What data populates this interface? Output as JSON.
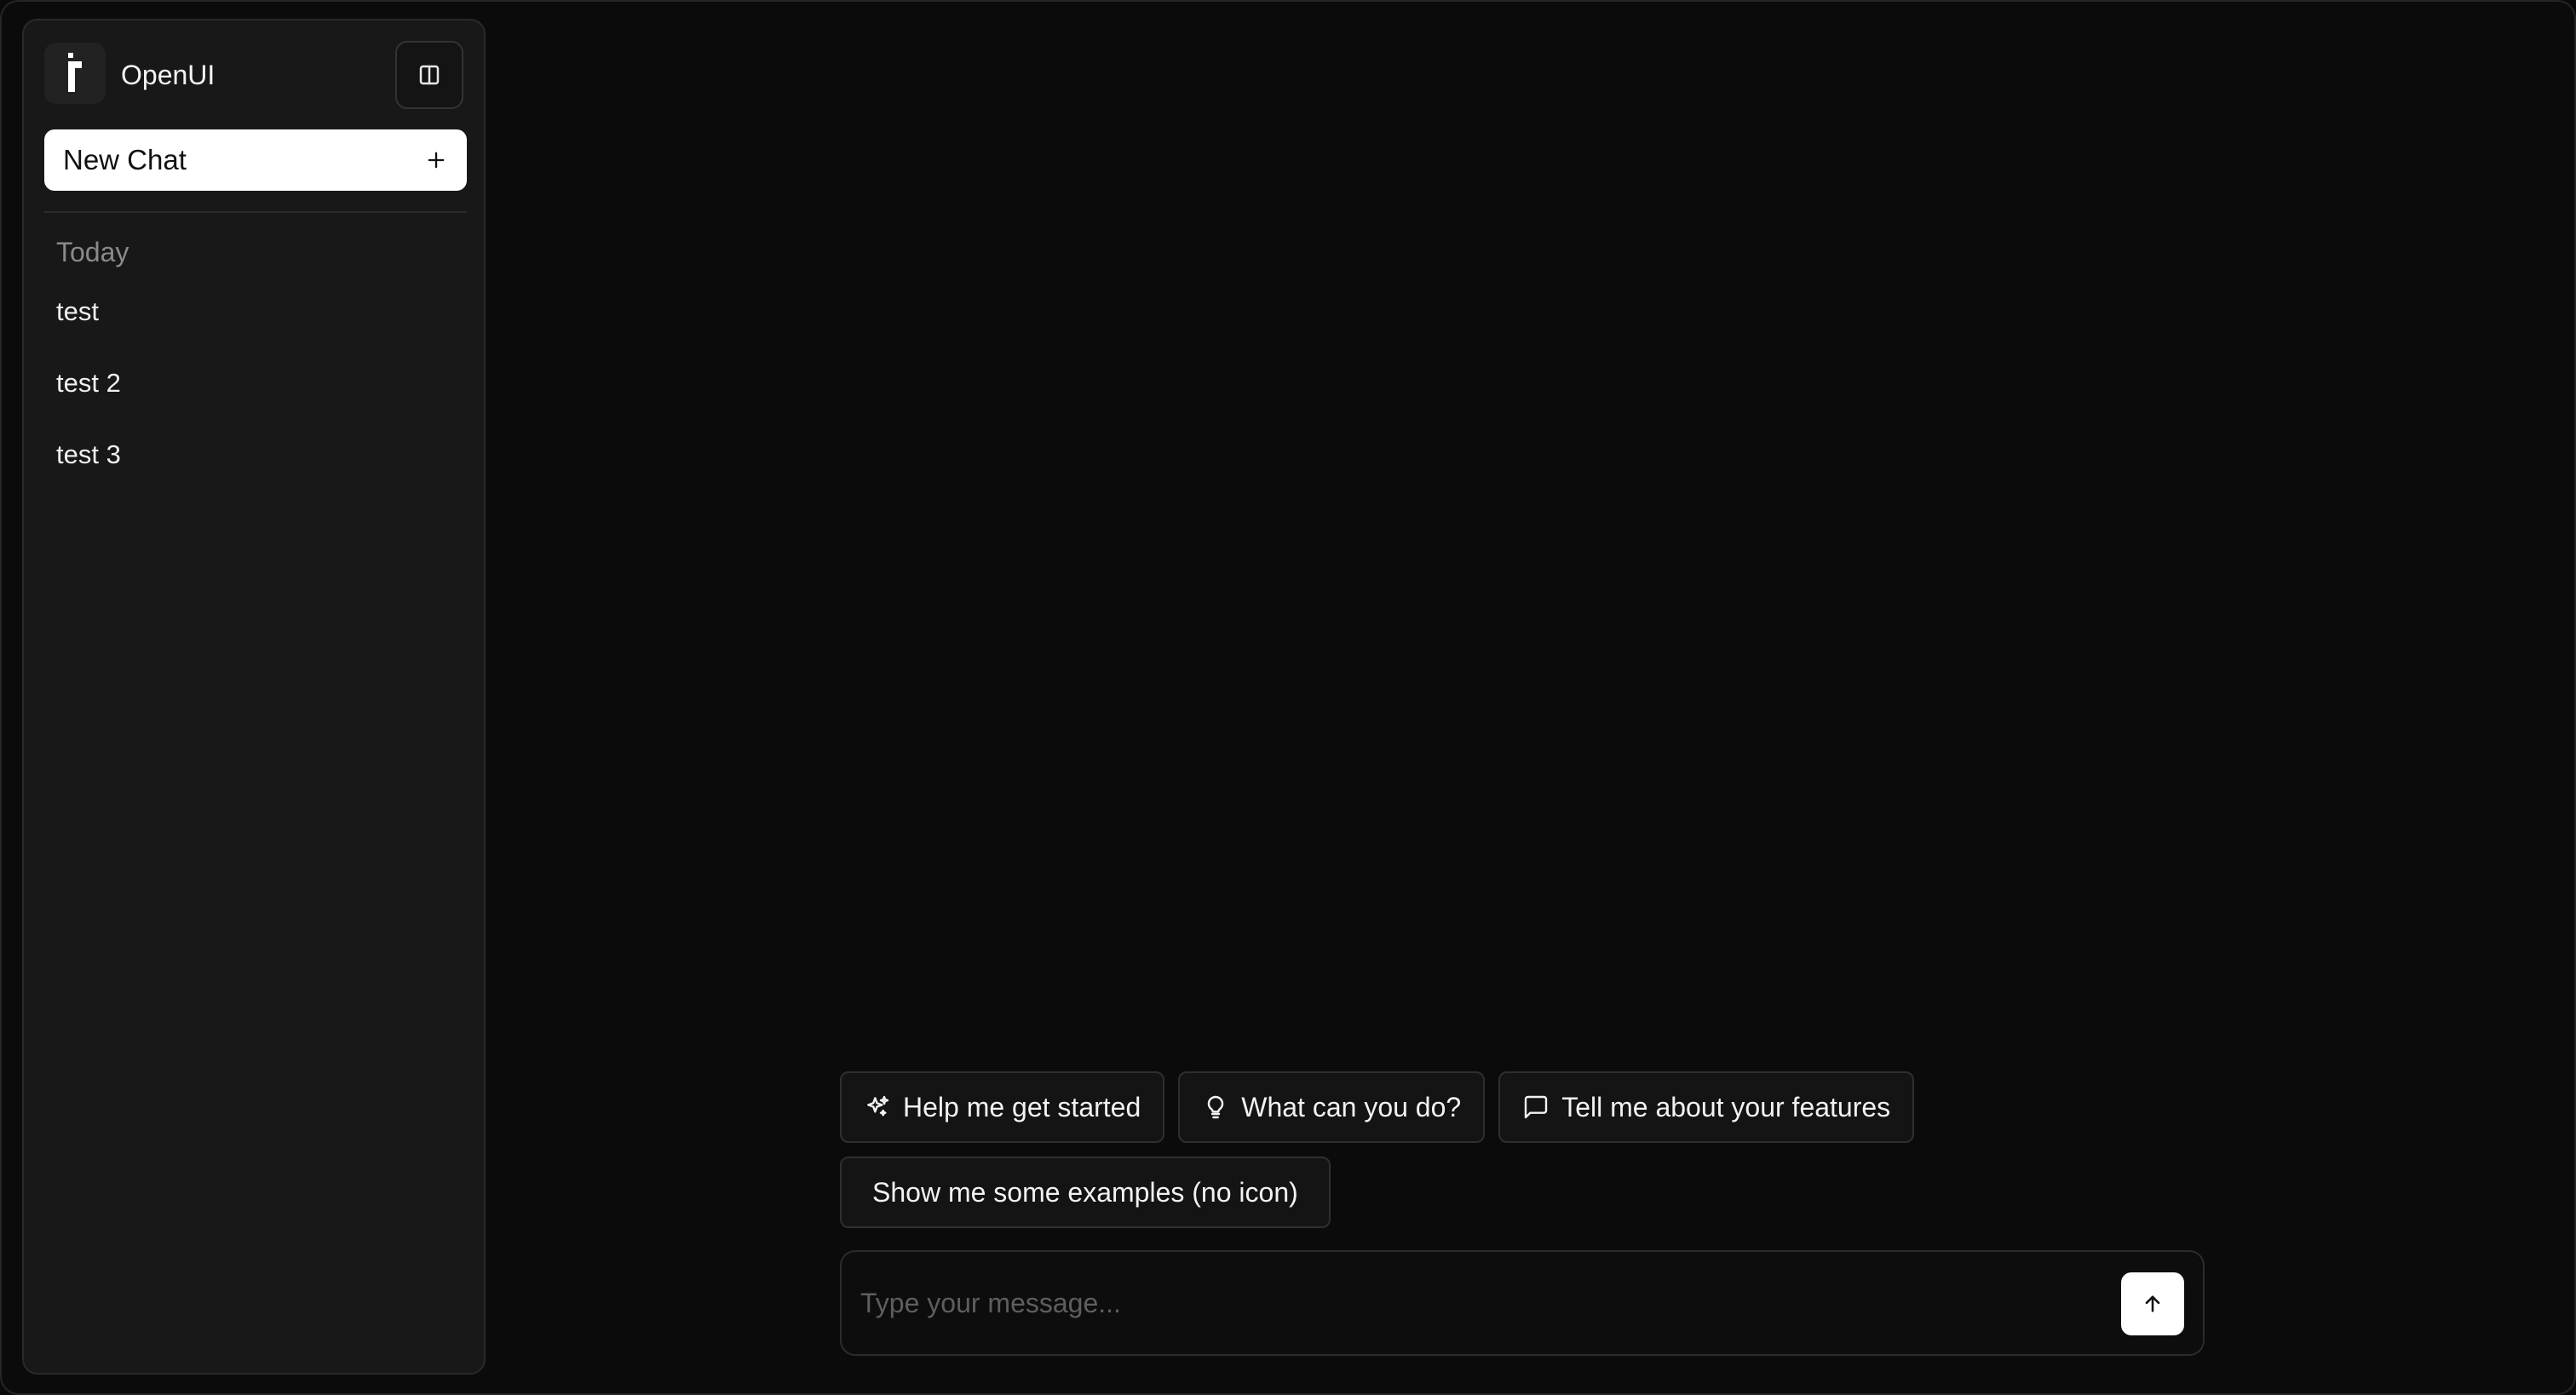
{
  "sidebar": {
    "brand": "OpenUI",
    "new_chat_label": "New Chat",
    "section_label": "Today",
    "history": [
      {
        "label": "test"
      },
      {
        "label": "test 2"
      },
      {
        "label": "test 3"
      }
    ]
  },
  "suggestions": [
    {
      "label": "Help me get started",
      "icon": "sparkles-icon"
    },
    {
      "label": "What can you do?",
      "icon": "lightbulb-icon"
    },
    {
      "label": "Tell me about your features",
      "icon": "message-square-icon"
    },
    {
      "label": "Show me some examples (no icon)",
      "icon": ""
    }
  ],
  "composer": {
    "placeholder": "Type your message...",
    "value": ""
  },
  "colors": {
    "background": "#0b0b0b",
    "sidebar": "#181818",
    "accent_button": "#ffffff"
  }
}
